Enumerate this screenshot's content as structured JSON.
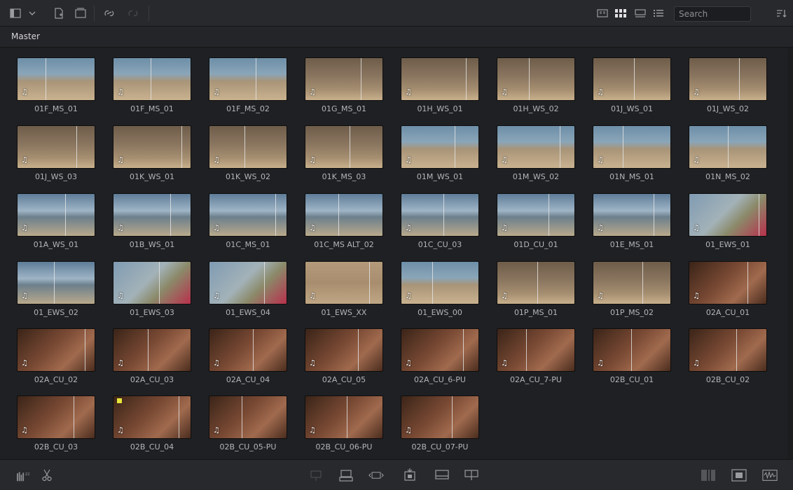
{
  "toolbar": {
    "search_placeholder": "Search",
    "icons": [
      "sidebar-toggle-icon",
      "chevron-down-icon",
      "new-clip-icon",
      "new-bin-icon",
      "link-icon",
      "unlink-icon",
      "metadata-view-icon",
      "thumbnail-view-icon",
      "filmstrip-view-icon",
      "list-view-icon",
      "sort-icon"
    ]
  },
  "breadcrumb": {
    "label": "Master"
  },
  "clips": [
    {
      "name": "01F_MS_01",
      "scene": "beach"
    },
    {
      "name": "01F_MS_01",
      "scene": "beach"
    },
    {
      "name": "01F_MS_02",
      "scene": "beach"
    },
    {
      "name": "01G_MS_01",
      "scene": "rock"
    },
    {
      "name": "01H_WS_01",
      "scene": "rock"
    },
    {
      "name": "01H_WS_02",
      "scene": "rock"
    },
    {
      "name": "01J_WS_01",
      "scene": "rock"
    },
    {
      "name": "01J_WS_02",
      "scene": "rock"
    },
    {
      "name": "01J_WS_03",
      "scene": "rock"
    },
    {
      "name": "01K_WS_01",
      "scene": "rock"
    },
    {
      "name": "01K_WS_02",
      "scene": "rock"
    },
    {
      "name": "01K_MS_03",
      "scene": "rock"
    },
    {
      "name": "01M_WS_01",
      "scene": "beach"
    },
    {
      "name": "01M_WS_02",
      "scene": "beach"
    },
    {
      "name": "01N_MS_01",
      "scene": "beach"
    },
    {
      "name": "01N_MS_02",
      "scene": "beach"
    },
    {
      "name": "01A_WS_01",
      "scene": "coast"
    },
    {
      "name": "01B_WS_01",
      "scene": "coast"
    },
    {
      "name": "01C_MS_01",
      "scene": "coast"
    },
    {
      "name": "01C_MS ALT_02",
      "scene": "coast"
    },
    {
      "name": "01C_CU_03",
      "scene": "coast"
    },
    {
      "name": "01D_CU_01",
      "scene": "coast"
    },
    {
      "name": "01E_MS_01",
      "scene": "coast"
    },
    {
      "name": "01_EWS_01",
      "scene": "flowers"
    },
    {
      "name": "01_EWS_02",
      "scene": "coast"
    },
    {
      "name": "01_EWS_03",
      "scene": "flowers"
    },
    {
      "name": "01_EWS_04",
      "scene": "flowers"
    },
    {
      "name": "01_EWS_XX",
      "scene": "sand"
    },
    {
      "name": "01_EWS_00",
      "scene": "beach"
    },
    {
      "name": "01P_MS_01",
      "scene": "rock"
    },
    {
      "name": "01P_MS_02",
      "scene": "rock"
    },
    {
      "name": "02A_CU_01",
      "scene": "dark"
    },
    {
      "name": "02A_CU_02",
      "scene": "dark"
    },
    {
      "name": "02A_CU_03",
      "scene": "dark"
    },
    {
      "name": "02A_CU_04",
      "scene": "dark"
    },
    {
      "name": "02A_CU_05",
      "scene": "dark"
    },
    {
      "name": "02A_CU_6-PU",
      "scene": "dark"
    },
    {
      "name": "02A_CU_7-PU",
      "scene": "dark"
    },
    {
      "name": "02B_CU_01",
      "scene": "dark"
    },
    {
      "name": "02B_CU_02",
      "scene": "dark"
    },
    {
      "name": "02B_CU_03",
      "scene": "dark"
    },
    {
      "name": "02B_CU_04",
      "scene": "dark",
      "flagged": true
    },
    {
      "name": "02B_CU_05-PU",
      "scene": "dark"
    },
    {
      "name": "02B_CU_06-PU",
      "scene": "dark"
    },
    {
      "name": "02B_CU_07-PU",
      "scene": "dark"
    }
  ],
  "bottombar": {
    "icons": [
      "clip-sleep-icon",
      "cut-icon",
      "insert-icon",
      "overwrite-icon",
      "replace-icon",
      "fit-to-fill-icon",
      "place-on-top-icon",
      "append-icon",
      "ripple-overwrite-icon",
      "source-view-icon",
      "timeline-view-icon",
      "audio-waveform-icon"
    ]
  },
  "colors": {
    "accent": "#e7e73a",
    "background": "#1f2023"
  }
}
